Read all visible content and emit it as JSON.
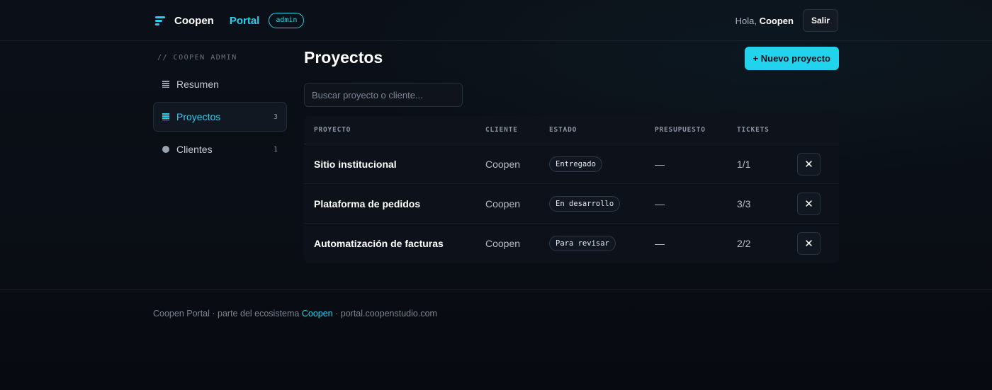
{
  "header": {
    "brand_name": "Coopen",
    "brand_portal": "Portal",
    "role_badge": "admin",
    "greeting_prefix": "Hola, ",
    "user_name": "Coopen",
    "logout_label": "Salir",
    "logo_icon": "bars-logo-icon"
  },
  "sidebar": {
    "caption": "// COOPEN ADMIN",
    "items": [
      {
        "label": "Resumen",
        "icon": "grid-icon",
        "count": ""
      },
      {
        "label": "Proyectos",
        "icon": "list-icon",
        "count": "3"
      },
      {
        "label": "Clientes",
        "icon": "dot-icon",
        "count": "1"
      }
    ]
  },
  "main": {
    "title": "Proyectos",
    "new_button": "+ Nuevo proyecto",
    "search_placeholder": "Buscar proyecto o cliente...",
    "columns": [
      "PROYECTO",
      "CLIENTE",
      "ESTADO",
      "PRESUPUESTO",
      "TICKETS"
    ],
    "rows": [
      {
        "project": "Sitio institucional",
        "client": "Coopen",
        "status": "Entregado",
        "budget": "—",
        "tickets": "1/1"
      },
      {
        "project": "Plataforma de pedidos",
        "client": "Coopen",
        "status": "En desarrollo",
        "budget": "—",
        "tickets": "3/3"
      },
      {
        "project": "Automatización de facturas",
        "client": "Coopen",
        "status": "Para revisar",
        "budget": "—",
        "tickets": "2/2"
      }
    ],
    "delete_icon": "close-icon",
    "delete_glyph": "✕"
  },
  "footer": {
    "prefix": "Coopen Portal · parte del ecosistema ",
    "link": "Coopen",
    "suffix": " · portal.coopenstudio.com"
  },
  "colors": {
    "accent": "#22d3ee",
    "background": "#0a0e15"
  }
}
